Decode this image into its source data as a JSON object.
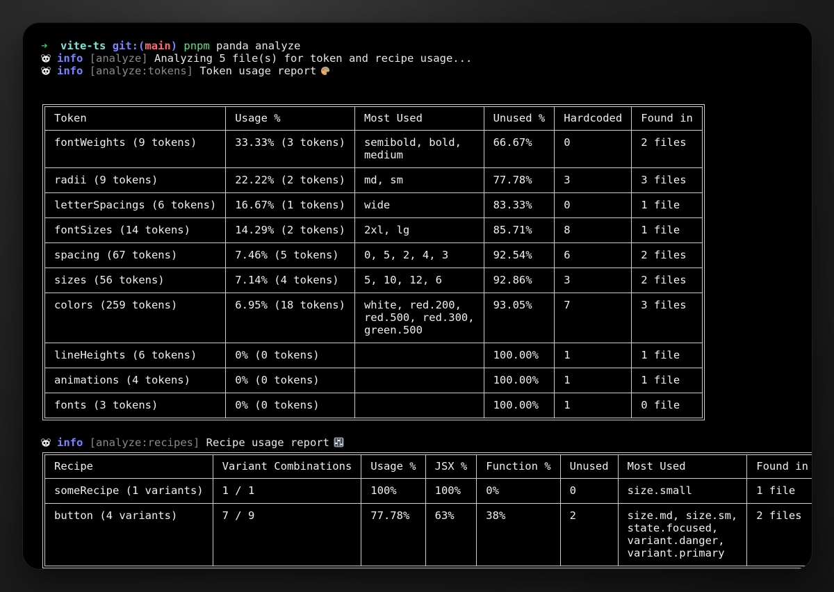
{
  "prompt": {
    "arrow": "➜",
    "dir": "vite-ts",
    "git_label": "git:(",
    "branch": "main",
    "git_close": ")",
    "command_bin": "pnpm",
    "command_args": "panda analyze"
  },
  "log": [
    {
      "level": "info",
      "tag": "[analyze]",
      "message": "Analyzing 5 file(s) for token and recipe usage..."
    },
    {
      "level": "info",
      "tag": "[analyze:tokens]",
      "message": "Token usage report",
      "emoji": "🎨"
    }
  ],
  "recipe_log": {
    "level": "info",
    "tag": "[analyze:recipes]",
    "message": "Recipe usage report",
    "emoji": "🎛"
  },
  "token_table": {
    "headers": [
      "Token",
      "Usage %",
      "Most Used",
      "Unused %",
      "Hardcoded",
      "Found in"
    ],
    "rows": [
      [
        "fontWeights (9 tokens)",
        "33.33% (3 tokens)",
        "semibold, bold,\nmedium",
        "66.67%",
        "0",
        "2 files"
      ],
      [
        "radii (9 tokens)",
        "22.22% (2 tokens)",
        "md, sm",
        "77.78%",
        "3",
        "3 files"
      ],
      [
        "letterSpacings (6 tokens)",
        "16.67% (1 tokens)",
        "wide",
        "83.33%",
        "0",
        "1 file"
      ],
      [
        "fontSizes (14 tokens)",
        "14.29% (2 tokens)",
        "2xl, lg",
        "85.71%",
        "8",
        "1 file"
      ],
      [
        "spacing (67 tokens)",
        "7.46% (5 tokens)",
        "0, 5, 2, 4, 3",
        "92.54%",
        "6",
        "2 files"
      ],
      [
        "sizes (56 tokens)",
        "7.14% (4 tokens)",
        "5, 10, 12, 6",
        "92.86%",
        "3",
        "2 files"
      ],
      [
        "colors (259 tokens)",
        "6.95% (18 tokens)",
        "white, red.200,\nred.500, red.300,\ngreen.500",
        "93.05%",
        "7",
        "3 files"
      ],
      [
        "lineHeights (6 tokens)",
        "0% (0 tokens)",
        "",
        "100.00%",
        "1",
        "1 file"
      ],
      [
        "animations (4 tokens)",
        "0% (0 tokens)",
        "",
        "100.00%",
        "1",
        "1 file"
      ],
      [
        "fonts (3 tokens)",
        "0% (0 tokens)",
        "",
        "100.00%",
        "1",
        "0 file"
      ]
    ]
  },
  "recipe_table": {
    "headers": [
      "Recipe",
      "Variant Combinations",
      "Usage %",
      "JSX %",
      "Function %",
      "Unused",
      "Most Used",
      "Found in"
    ],
    "rows": [
      [
        "someRecipe (1 variants)",
        "1 / 1",
        "100%",
        "100%",
        "0%",
        "0",
        "size.small",
        "1 file"
      ],
      [
        "button (4 variants)",
        "7 / 9",
        "77.78%",
        "63%",
        "38%",
        "2",
        "size.md, size.sm,\nstate.focused,\nvariant.danger,\nvariant.primary",
        "2 files"
      ]
    ]
  }
}
